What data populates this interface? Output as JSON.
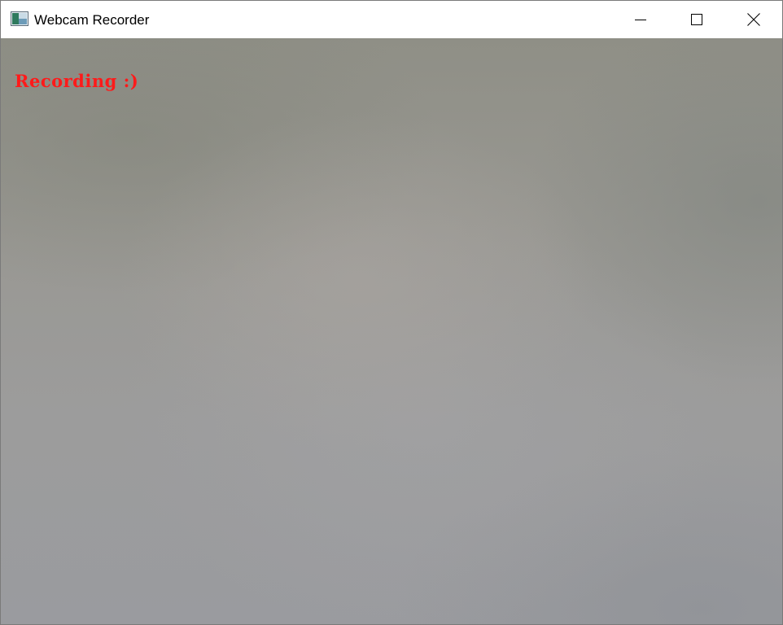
{
  "window": {
    "title": "Webcam Recorder",
    "icon": "app-icon",
    "controls": {
      "minimize": "minimize-icon",
      "maximize": "maximize-icon",
      "close": "close-icon"
    }
  },
  "video": {
    "overlay_text": "Recording :)",
    "overlay_color": "#ff1a1a"
  }
}
